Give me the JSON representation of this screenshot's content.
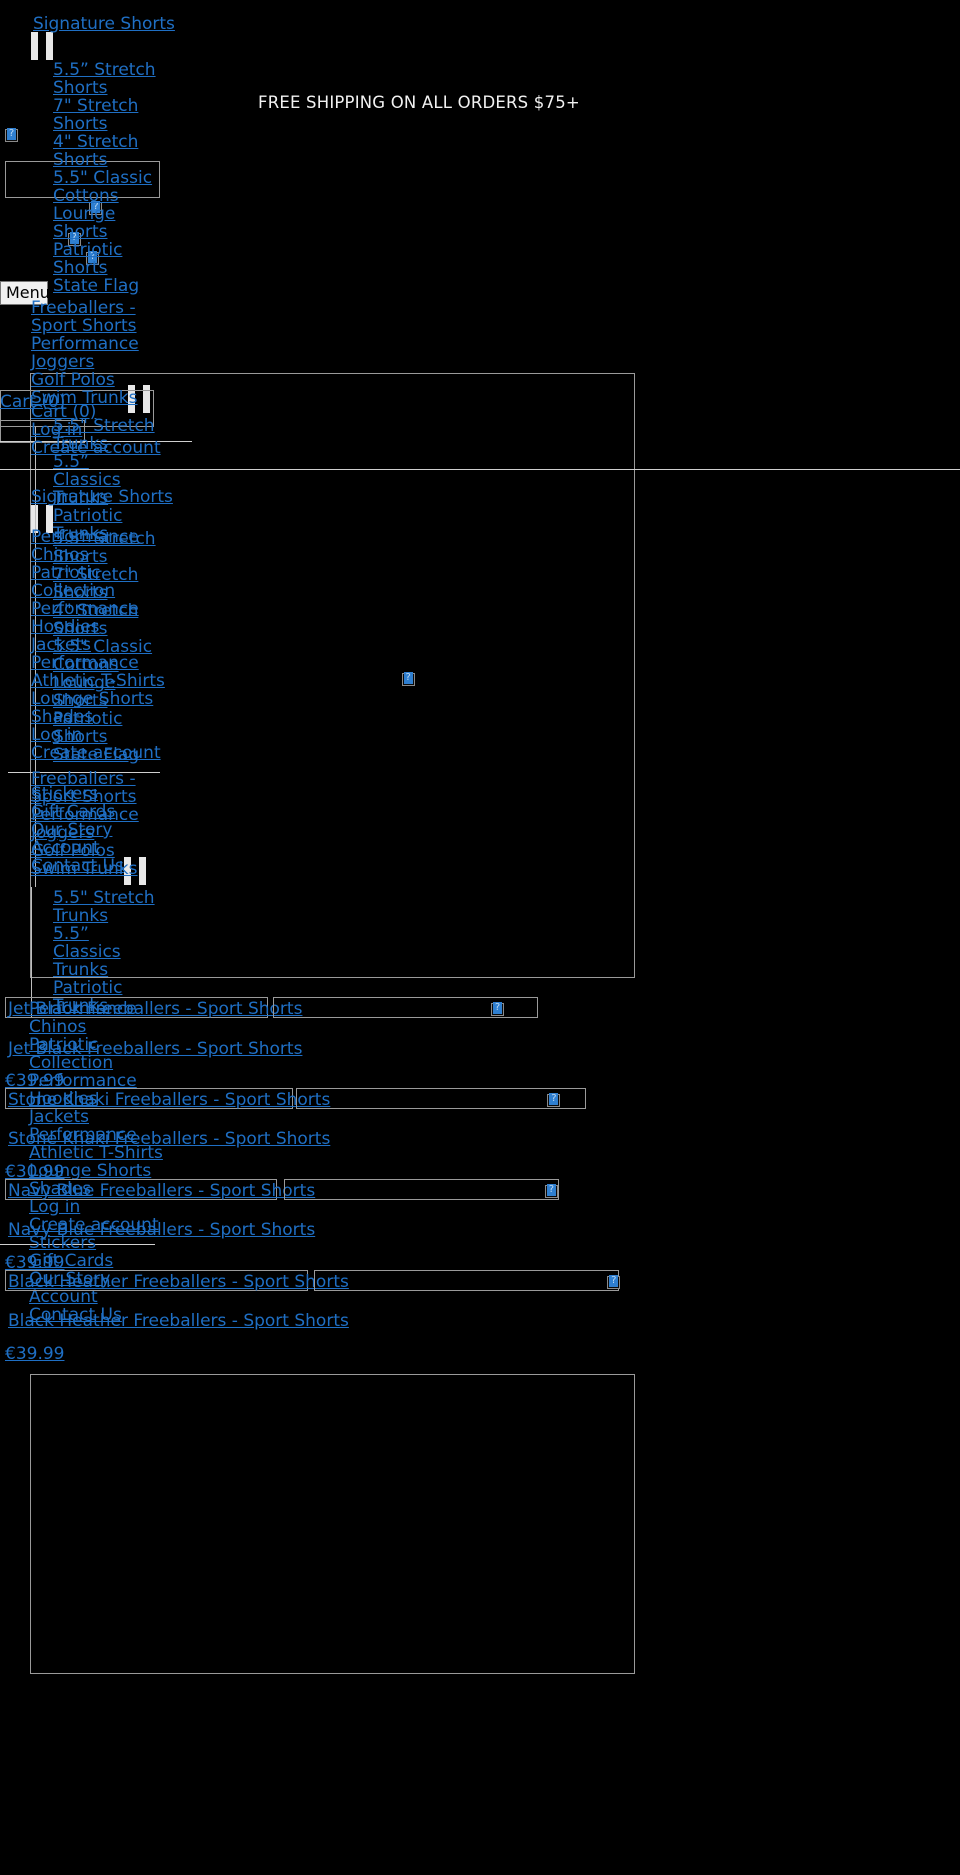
{
  "banner": {
    "text": "FREE SHIPPING ON ALL ORDERS $75+"
  },
  "menu_button": {
    "label": "Menu"
  },
  "nav_primary": {
    "heading": "Signature Shorts",
    "items": [
      "5.5” Stretch Shorts",
      "7\" Stretch Shorts",
      "4\" Stretch Shorts",
      "5.5\" Classic Cottons",
      "Lounge Shorts",
      "Patriotic Shorts",
      "State Flag",
      "Freeballers - Sport Shorts",
      "Performance Joggers",
      "Golf Polos",
      "Swim Trunks"
    ]
  },
  "nav_swim": {
    "items": [
      "5.5\" Stretch Trunks",
      "5.5” Classics Trunks",
      "Patriotic Trunks"
    ]
  },
  "nav_account_top": {
    "cart": "Cart (0)",
    "login": "Log in",
    "create": "Create account"
  },
  "nav_secondary": {
    "heading": "Signature Shorts",
    "items": [
      "Performance Chinos",
      "Patriotic Collection",
      "Performance Hoodies",
      "Jackets",
      "Performance Athletic T-Shirts",
      "Lounge Shorts",
      "Shades",
      "Log in",
      "Create account",
      "Stickers",
      "Gift Cards",
      "Our Story",
      "Account",
      "Contact Us"
    ]
  },
  "nav_overlay_shorts": {
    "items": [
      "5.5” Stretch Shorts",
      "7\" Stretch Shorts",
      "4\" Stretch Shorts",
      "5.5\" Classic Cottons",
      "Lounge Shorts",
      "Patriotic Shorts",
      "State Flag",
      "Freeballers - Sport Shorts",
      "Performance Joggers",
      "Golf Polos",
      "Swim Trunks"
    ]
  },
  "nav_overlay_swim": {
    "items": [
      "5.5\" Stretch Trunks",
      "5.5” Classics Trunks",
      "Patriotic Trunks"
    ]
  },
  "nav_overlay_more": {
    "items": [
      "Performance Chinos",
      "Patriotic Collection",
      "Performance Hoodies",
      "Jackets",
      "Performance Athletic T-Shirts",
      "Lounge Shorts",
      "Shades",
      "Log in",
      "Create account",
      "Stickers",
      "Gift Cards",
      "Our Story",
      "Account",
      "Contact Us"
    ]
  },
  "products": [
    {
      "name": "Jet Black Freeballers - Sport Shorts",
      "link": "Jet Black Freeballers - Sport Shorts",
      "price": "€39.99"
    },
    {
      "name": "Stone Khaki Freeballers - Sport Shorts",
      "link": "Stone Khaki Freeballers - Sport Shorts",
      "price": "€30.99"
    },
    {
      "name": "Navy Blue Freeballers - Sport Shorts",
      "link": "Navy Blue Freeballers - Sport Shorts",
      "price": "€39.99"
    },
    {
      "name": "Black Heather Freeballers - Sport Shorts",
      "link": "Black Heather Freeballers - Sport Shorts",
      "price": "€39.99"
    }
  ],
  "icons": {
    "broken_image": "broken-image-icon"
  }
}
